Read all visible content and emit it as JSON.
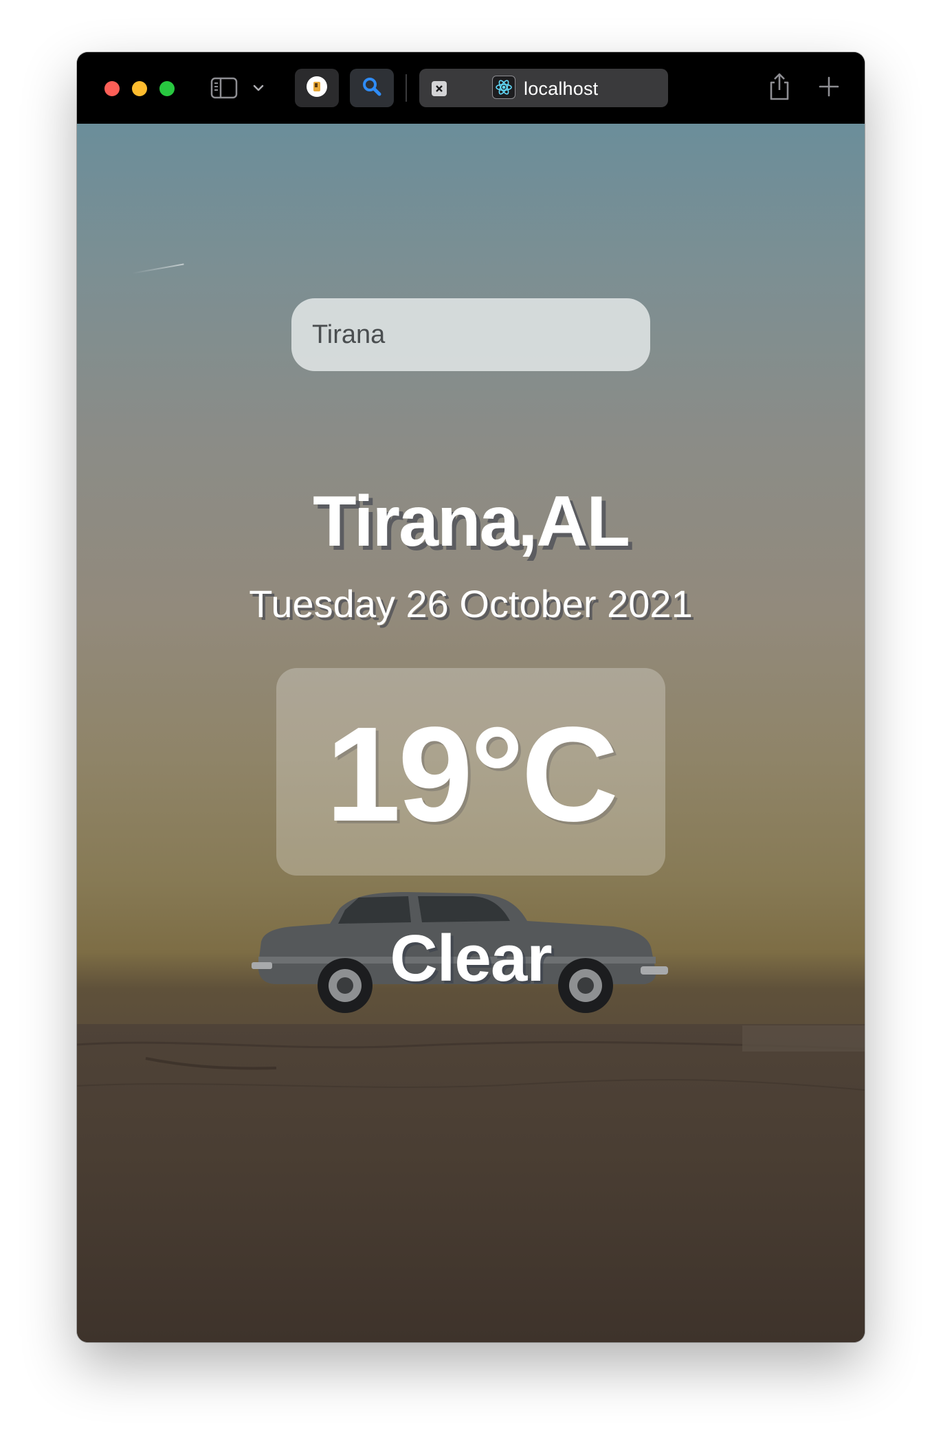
{
  "browser": {
    "tab_title": "localhost",
    "icons": {
      "sidebar": "sidebar-icon",
      "chevron": "chevron-down-icon",
      "extension_1": "extension-icon",
      "extension_2": "search-icon",
      "tab_close": "close-icon",
      "favicon": "react-logo-icon",
      "share": "share-icon",
      "new_tab": "plus-icon"
    }
  },
  "search": {
    "value": "Tirana"
  },
  "weather": {
    "location": "Tirana,AL",
    "date": "Tuesday 26 October 2021",
    "temperature": "19°C",
    "condition": "Clear"
  },
  "colors": {
    "sky_top": "#6b8e9a",
    "sky_horizon": "#877a55",
    "ground": "#463a30",
    "text": "#ffffff"
  }
}
